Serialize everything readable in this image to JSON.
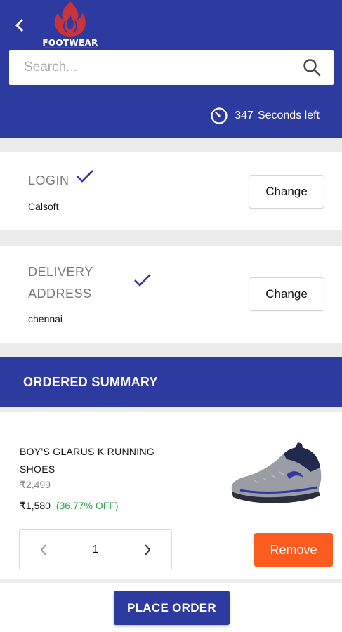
{
  "header": {
    "logo_text": "FOOTWEAR",
    "search_placeholder": "Search...",
    "timer": {
      "count": "347",
      "label": "Seconds left"
    }
  },
  "login": {
    "heading": "LOGIN",
    "value": "Calsoft",
    "change_label": "Change"
  },
  "delivery": {
    "heading_line1": "DELIVERY",
    "heading_line2": "ADDRESS",
    "value": "chennai",
    "change_label": "Change"
  },
  "summary": {
    "title": "ORDERED SUMMARY",
    "product": {
      "name": "BOY'S GLARUS K RUNNING SHOES",
      "original_price": "₹2,499",
      "price": "₹1,580",
      "discount": "(36.77% OFF)",
      "quantity": "1",
      "remove_label": "Remove"
    }
  },
  "footer": {
    "place_order_label": "PLACE ORDER"
  },
  "colors": {
    "primary": "#2d3aa0",
    "remove": "#fc5c20",
    "discount": "#2e9d4c",
    "logo_red": "#c9343a"
  },
  "icons": [
    "back-arrow-icon",
    "flame-logo-icon",
    "search-icon",
    "timer-icon",
    "check-icon",
    "chevron-left-icon",
    "chevron-right-icon"
  ]
}
